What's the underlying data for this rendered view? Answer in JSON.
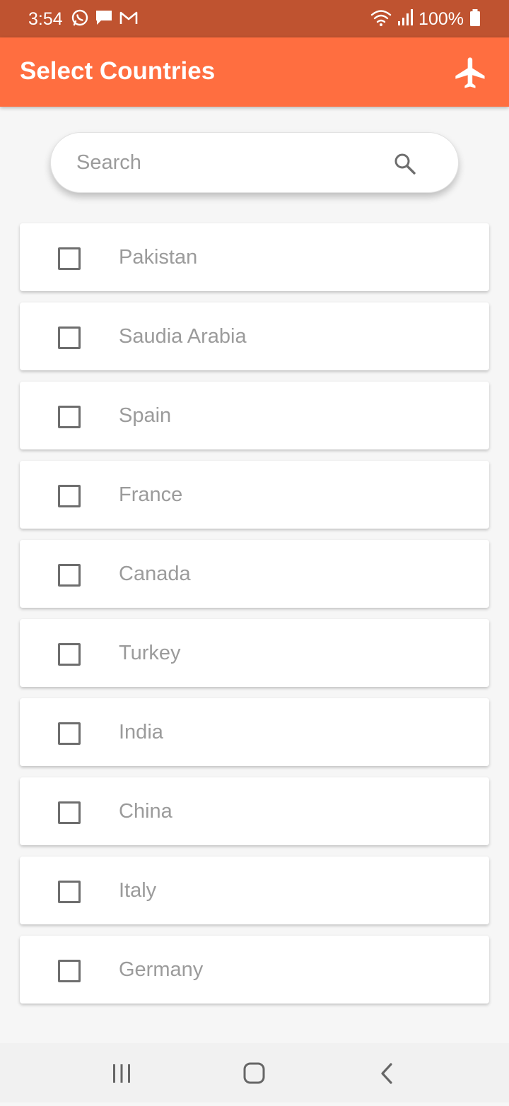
{
  "status_bar": {
    "time": "3:54",
    "battery_percent": "100%",
    "left_icons": [
      "whatsapp-icon",
      "message-icon",
      "gmail-icon"
    ],
    "right_icons": [
      "wifi-icon",
      "signal-icon",
      "battery-icon"
    ]
  },
  "app_bar": {
    "title": "Select Countries",
    "action_icon": "airplane-icon"
  },
  "search": {
    "placeholder": "Search",
    "value": "",
    "icon": "search-icon"
  },
  "countries": [
    {
      "label": "Pakistan",
      "checked": false
    },
    {
      "label": "Saudia Arabia",
      "checked": false
    },
    {
      "label": "Spain",
      "checked": false
    },
    {
      "label": "France",
      "checked": false
    },
    {
      "label": "Canada",
      "checked": false
    },
    {
      "label": "Turkey",
      "checked": false
    },
    {
      "label": "India",
      "checked": false
    },
    {
      "label": "China",
      "checked": false
    },
    {
      "label": "Italy",
      "checked": false
    },
    {
      "label": "Germany",
      "checked": false
    }
  ],
  "nav_bar": {
    "buttons": [
      "recent-apps-icon",
      "home-icon",
      "back-icon"
    ]
  },
  "colors": {
    "status_bar": "#BF5330",
    "app_bar": "#FF6E40",
    "background": "#F6F6F6",
    "card": "#FFFFFF",
    "label_text": "#9B9B9B",
    "checkbox_border": "#6E6E6E",
    "nav_bar": "#F1F1F1"
  }
}
